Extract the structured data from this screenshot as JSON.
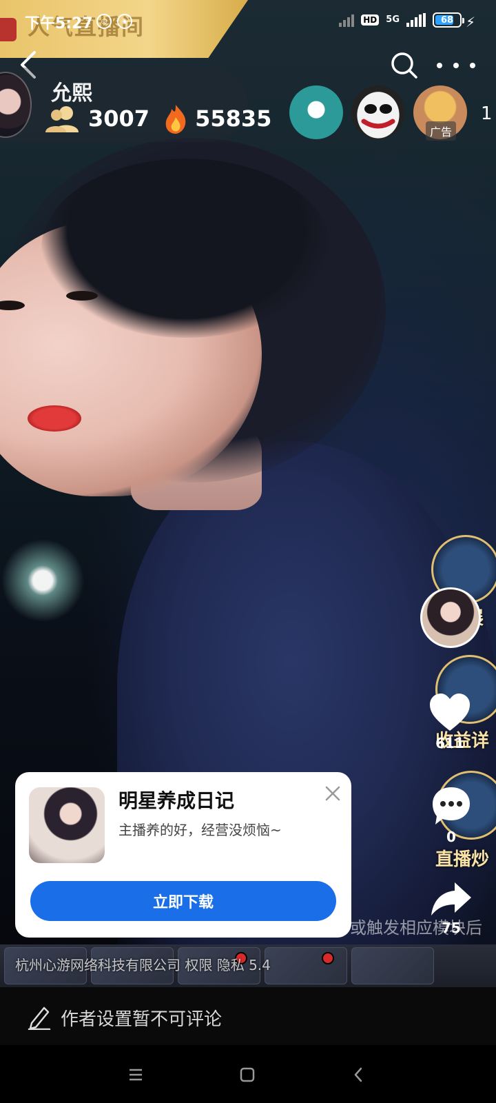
{
  "status_bar": {
    "time": "下午5:27",
    "network": "5G",
    "hd_label": "HD",
    "battery": "68",
    "banner_text": "人气直播间"
  },
  "live_room": {
    "anchor_name": "允熙",
    "viewer_count": "3007",
    "heat_count": "55835",
    "viewers_more": "1",
    "ad_tag": "广告"
  },
  "right_rail": {
    "promo_1_label": "展",
    "promo_2_label": "收益详",
    "promo_3_label": "直播炒",
    "like_count": "611",
    "comment_count": "0",
    "share_count": "75"
  },
  "ticker_text": "或触发相应模块后",
  "company_line": {
    "company": "杭州心游网络科技有限公司",
    "permission": "权限",
    "privacy": "隐私",
    "version": "5.4"
  },
  "ad_card": {
    "title": "明星养成日记",
    "subtitle": "主播养的好，经营没烦恼~",
    "cta_label": "立即下载"
  },
  "comment_bar": {
    "text": "作者设置暂不可评论"
  },
  "icons": {
    "back": "back-icon",
    "search": "search-icon",
    "more": "more-icon",
    "like": "heart-icon",
    "comment": "comment-icon",
    "share": "share-icon",
    "close": "close-icon",
    "edit": "pencil-icon"
  },
  "colors": {
    "cta_blue": "#1a6fe8",
    "banner_gold": "#e9c46a"
  }
}
